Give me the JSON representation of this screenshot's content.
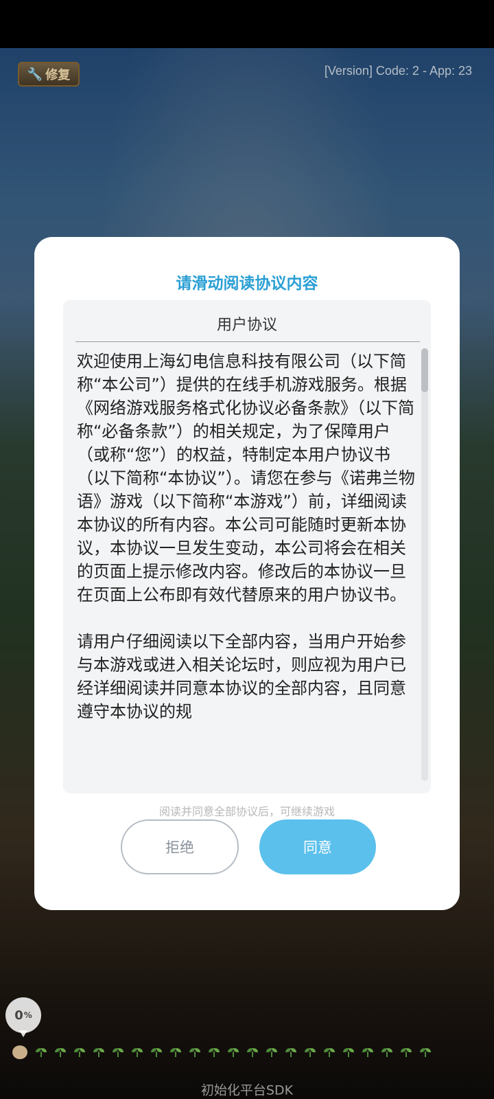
{
  "header": {
    "repair_label": "修复",
    "version_text": "[Version] Code: 2 - App: 23"
  },
  "dialog": {
    "title": "请滑动阅读协议内容",
    "agreement_heading": "用户协议",
    "agreement_body": "欢迎使用上海幻电信息科技有限公司（以下简称“本公司”）提供的在线手机游戏服务。根据《网络游戏服务格式化协议必备条款》（以下简称“必备条款”）的相关规定，为了保障用户（或称“您”）的权益，特制定本用户协议书（以下简称“本协议”）。请您在参与《诺弗兰物语》游戏（以下简称“本游戏”）前，详细阅读本协议的所有内容。本公司可能随时更新本协议，本协议一旦发生变动，本公司将会在相关的页面上提示修改内容。修改后的本协议一旦在页面上公布即有效代替原来的用户协议书。\n\n请用户仔细阅读以下全部内容，当用户开始参与本游戏或进入相关论坛时，则应视为用户已经详细阅读并同意本协议的全部内容，且同意遵守本协议的规",
    "hint": "阅读并同意全部协议后，可继续游戏",
    "reject_label": "拒绝",
    "agree_label": "同意"
  },
  "loading": {
    "percent_value": "0",
    "percent_sign": "%",
    "progress": 0,
    "status_label": "初始化平台SDK"
  },
  "colors": {
    "title_accent": "#2a9fd4",
    "agree_button": "#5bc0ec",
    "reject_border": "#b5bcc4"
  }
}
